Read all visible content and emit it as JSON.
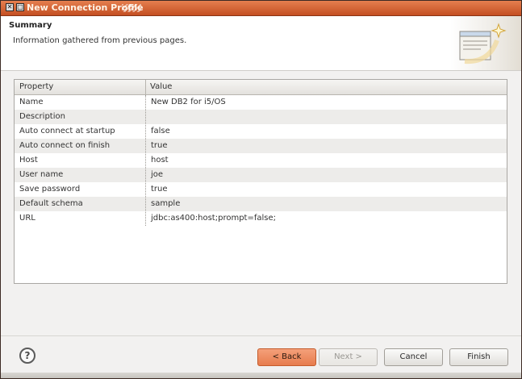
{
  "window": {
    "title": "New Connection Profile"
  },
  "header": {
    "title": "Summary",
    "description": "Information gathered from previous pages.",
    "banner_icon": "wizard-banner-icon"
  },
  "table": {
    "columns": [
      "Property",
      "Value"
    ],
    "rows": [
      {
        "property": "Name",
        "value": "New DB2 for i5/OS"
      },
      {
        "property": "Description",
        "value": ""
      },
      {
        "property": "Auto connect at startup",
        "value": "false"
      },
      {
        "property": "Auto connect on finish",
        "value": "true"
      },
      {
        "property": "Host",
        "value": "host"
      },
      {
        "property": "User name",
        "value": "joe"
      },
      {
        "property": "Save password",
        "value": "true"
      },
      {
        "property": "Default schema",
        "value": "sample"
      },
      {
        "property": "URL",
        "value": "jdbc:as400:host;prompt=false;"
      }
    ]
  },
  "buttons": {
    "help": "?",
    "back": "< Back",
    "next": "Next >",
    "cancel": "Cancel",
    "finish": "Finish"
  },
  "colors": {
    "titlebar": "#d35a2a",
    "back_button": "#e98a5d"
  }
}
